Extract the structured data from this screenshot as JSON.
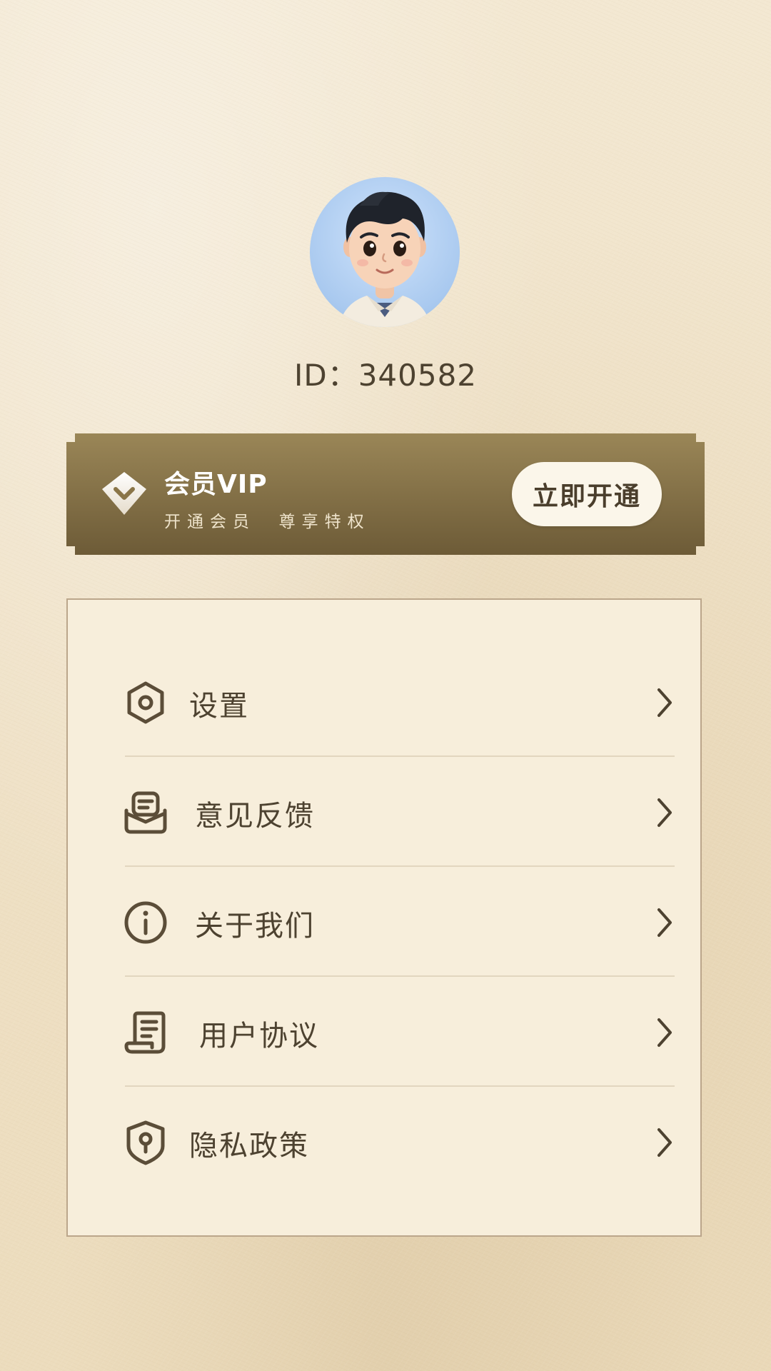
{
  "profile": {
    "id_label": "ID：340582"
  },
  "vip": {
    "title": "会员VIP",
    "subtitle": "开通会员  尊享特权",
    "button_label": "立即开通",
    "gradient_top": "#9a8657",
    "gradient_bottom": "#6d5b37"
  },
  "menu": {
    "items": [
      {
        "icon": "settings-hexagon-icon",
        "label": "设置"
      },
      {
        "icon": "feedback-mail-icon",
        "label": "意见反馈"
      },
      {
        "icon": "info-circle-icon",
        "label": "关于我们"
      },
      {
        "icon": "document-scroll-icon",
        "label": "用户协议"
      },
      {
        "icon": "privacy-shield-icon",
        "label": "隐私政策"
      }
    ]
  },
  "colors": {
    "text": "#4d4230",
    "card_bg": "#f7eedb",
    "card_border": "#bba68b",
    "icon": "#5b4d38"
  }
}
